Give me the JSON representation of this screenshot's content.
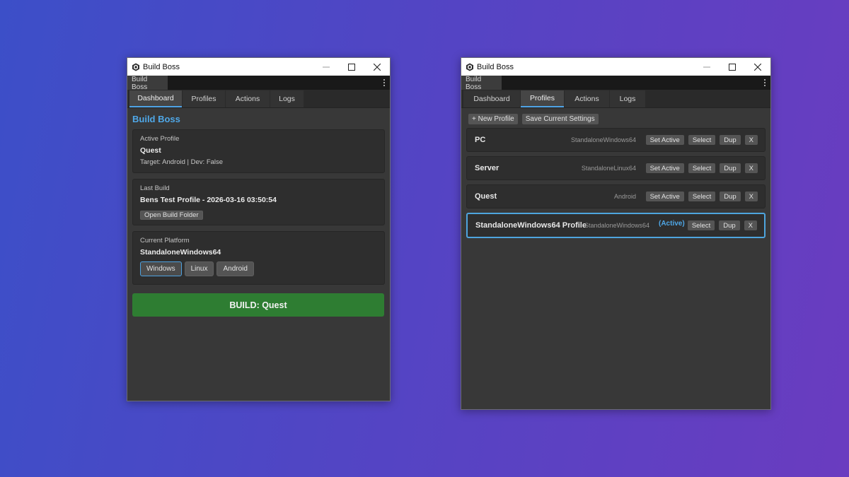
{
  "colors": {
    "accent": "#4fa8e8",
    "build_button": "#2e7d32",
    "window_bg": "#383838"
  },
  "left_window": {
    "title": "Build Boss",
    "doc_tab": "Build Boss",
    "tabs": [
      {
        "label": "Dashboard",
        "active": true
      },
      {
        "label": "Profiles",
        "active": false
      },
      {
        "label": "Actions",
        "active": false
      },
      {
        "label": "Logs",
        "active": false
      }
    ],
    "panel_title": "Build Boss",
    "active_profile": {
      "label": "Active Profile",
      "name": "Quest",
      "details": "Target: Android | Dev: False"
    },
    "last_build": {
      "label": "Last Build",
      "value": "Bens Test Profile - 2026-03-16 03:50:54",
      "open_folder_label": "Open Build Folder"
    },
    "current_platform": {
      "label": "Current Platform",
      "value": "StandaloneWindows64",
      "buttons": [
        {
          "label": "Windows",
          "selected": true
        },
        {
          "label": "Linux",
          "selected": false
        },
        {
          "label": "Android",
          "selected": false
        }
      ]
    },
    "build_button_label": "BUILD: Quest"
  },
  "right_window": {
    "title": "Build Boss",
    "doc_tab": "Build Boss",
    "tabs": [
      {
        "label": "Dashboard",
        "active": false
      },
      {
        "label": "Profiles",
        "active": true
      },
      {
        "label": "Actions",
        "active": false
      },
      {
        "label": "Logs",
        "active": false
      }
    ],
    "toolbar": {
      "new_profile": "+ New Profile",
      "save_settings": "Save Current Settings"
    },
    "profiles": [
      {
        "name": "PC",
        "target": "StandaloneWindows64",
        "active": false,
        "buttons": [
          "Set Active",
          "Select",
          "Dup",
          "X"
        ]
      },
      {
        "name": "Server",
        "target": "StandaloneLinux64",
        "active": false,
        "buttons": [
          "Set Active",
          "Select",
          "Dup",
          "X"
        ]
      },
      {
        "name": "Quest",
        "target": "Android",
        "active": false,
        "buttons": [
          "Set Active",
          "Select",
          "Dup",
          "X"
        ]
      },
      {
        "name": "StandaloneWindows64 Profile",
        "target": "StandaloneWindows64",
        "active": true,
        "active_label": "(Active)",
        "buttons": [
          "Select",
          "Dup",
          "X"
        ]
      }
    ]
  }
}
